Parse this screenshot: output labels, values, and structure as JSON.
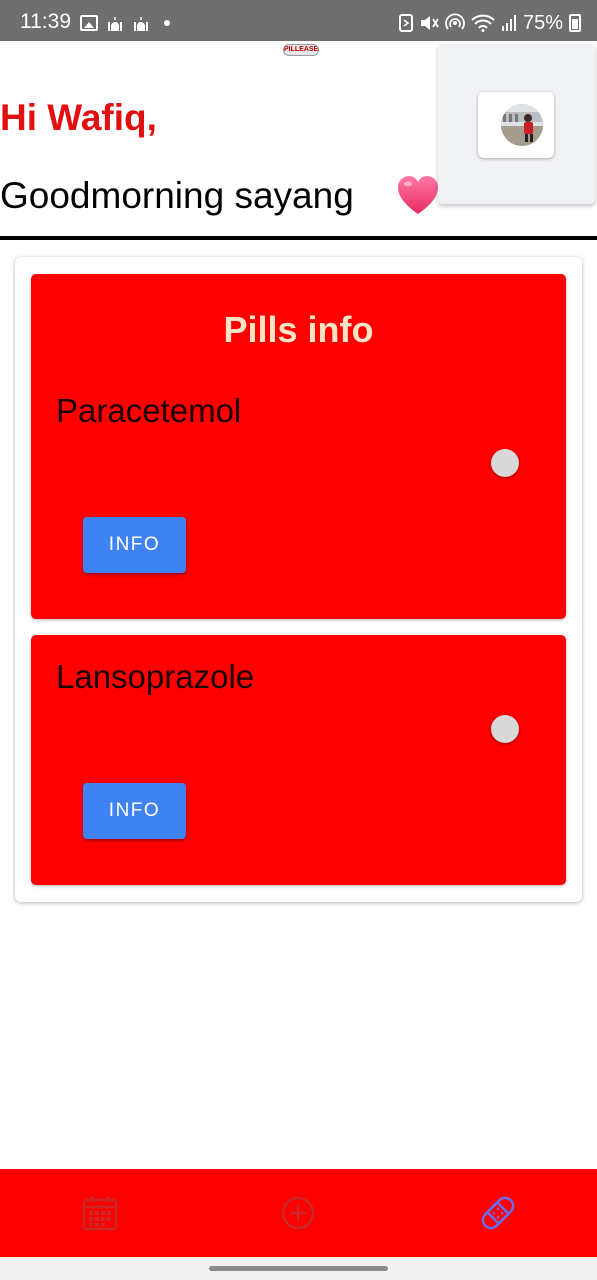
{
  "status_bar": {
    "time": "11:39",
    "battery": "75%",
    "left_icons": [
      "image-icon",
      "mosque-icon",
      "mosque-icon",
      "dot-icon"
    ],
    "right_icons": [
      "nfc-icon",
      "mute-icon",
      "hotspot-icon",
      "wifi-icon",
      "signal-icon",
      "battery-icon"
    ]
  },
  "header": {
    "logo_text": "PILLEASE",
    "greeting_name": "Hi Wafiq,",
    "greeting_message": "Goodmorning sayang",
    "heart_icon": "pink-heart-icon"
  },
  "pills": {
    "title": "Pills info",
    "items": [
      {
        "name": "Paracetemol",
        "button_label": "INFO",
        "toggle_on": false
      },
      {
        "name": "Lansoprazole",
        "button_label": "INFO",
        "toggle_on": false
      }
    ]
  },
  "bottom_nav": {
    "items": [
      {
        "icon": "calendar-icon",
        "active": false
      },
      {
        "icon": "add-circle-icon",
        "active": false
      },
      {
        "icon": "bandage-icon",
        "active": true
      }
    ]
  },
  "colors": {
    "accent_red": "#ff0000",
    "greeting_red": "#e01010",
    "button_blue": "#3f82f4",
    "title_cream": "#fde3c6",
    "active_nav": "#6b6bf0",
    "inactive_nav": "#c82a2a"
  }
}
